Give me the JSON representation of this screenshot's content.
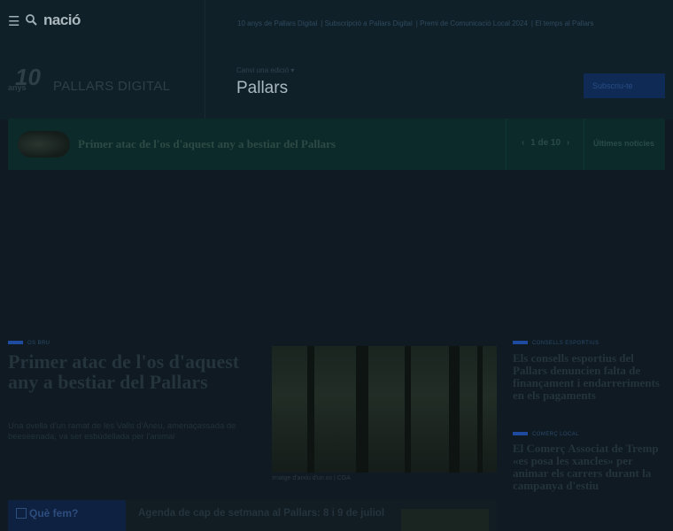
{
  "header": {
    "menu_icon": "hamburger-icon",
    "search_icon": "search-icon",
    "network_logo": "nació",
    "top_links": [
      "10 anys de Pallars Digital",
      "Subscripció a Pallars Digital",
      "Premi de Comunicació Local 2024",
      "El temps al Pallars"
    ],
    "logo_number": "10",
    "logo_anys": "anys",
    "site_name": "PALLARS DIGITAL",
    "edition_label": "Canvi una edició",
    "edition_name": "Pallars",
    "subscribe_label": "Subscriu-te"
  },
  "ticker": {
    "title": "Primer atac de l'os d'aquest any a bestiar del Pallars",
    "pager_text": "1 de 10",
    "prev_icon": "chevron-left-icon",
    "next_icon": "chevron-right-icon",
    "latest_label": "Últimes notícies"
  },
  "main_story": {
    "tag": "OS BRU",
    "title": "Primer atac de l'os d'aquest any a bestiar del Pallars",
    "excerpt": "Una ovella d'un ramat de les Valls d'Àneu, amenaçassada de beeseenada, va ser esbudellada per l'animal",
    "photo_caption": "Imatge d'arxiu d'un os | CGA"
  },
  "side_stories": [
    {
      "tag": "CONSELLS ESPORTIUS",
      "title": "Els consells esportius del Pallars denuncien falta de finançament i endarreriments en els pagaments"
    },
    {
      "tag": "COMERÇ LOCAL",
      "title": "El Comerç Associat de Tremp «es posa les xancles» per animar els carrers durant la campanya d'estiu"
    }
  ],
  "quefem": {
    "label": "Què fem?",
    "icon": "calendar-icon",
    "agenda_title": "Agenda de cap de setmana al Pallars: 8 i 9 de juliol"
  },
  "colors": {
    "ticker_bg": "#0c2a2a",
    "accent_blue": "#1e4aa0",
    "subscribe_bg": "#0e2a55"
  }
}
